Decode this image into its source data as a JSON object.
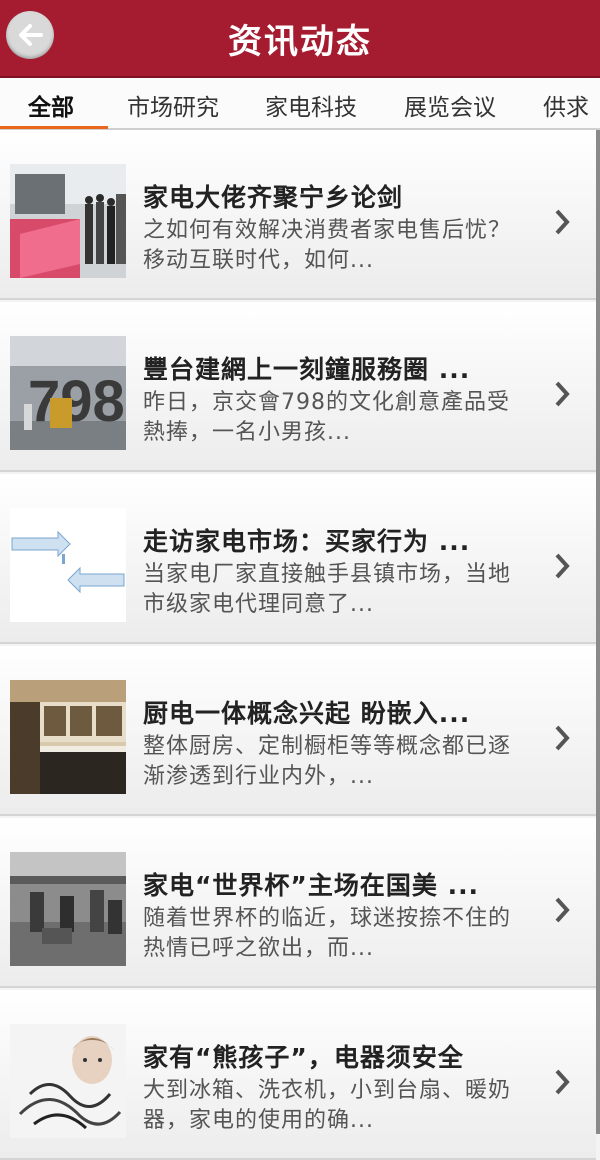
{
  "header": {
    "title": "资讯动态",
    "back_icon": "back-arrow-icon",
    "bg_color": "#a51c30"
  },
  "tabs": [
    {
      "label": "全部",
      "active": true
    },
    {
      "label": "市场研究",
      "active": false
    },
    {
      "label": "家电科技",
      "active": false
    },
    {
      "label": "展览会议",
      "active": false
    },
    {
      "label": "供求",
      "active": false
    }
  ],
  "accent_color": "#e8671c",
  "items": [
    {
      "title": "家电大佬齐聚宁乡论剑",
      "desc": "之如何有效解决消费者家电售后忧？移动互联时代，如何..."
    },
    {
      "title": "豐台建網上一刻鐘服務圈 ...",
      "desc": "昨日，京交會798的文化創意產品受熱捧，一名小男孩..."
    },
    {
      "title": "走访家电市场：买家行为 ...",
      "desc": "当家电厂家直接触手县镇市场，当地市级家电代理同意了..."
    },
    {
      "title": "厨电一体概念兴起 盼嵌入...",
      "desc": "整体厨房、定制橱柜等等概念都已逐渐渗透到行业内外，..."
    },
    {
      "title": "家电“世界杯”主场在国美 ...",
      "desc": "随着世界杯的临近，球迷按捺不住的热情已呼之欲出，而..."
    },
    {
      "title": "家有“熊孩子”，电器须安全",
      "desc": "大到冰箱、洗衣机，小到台扇、暖奶器，家电的使用的确..."
    }
  ]
}
